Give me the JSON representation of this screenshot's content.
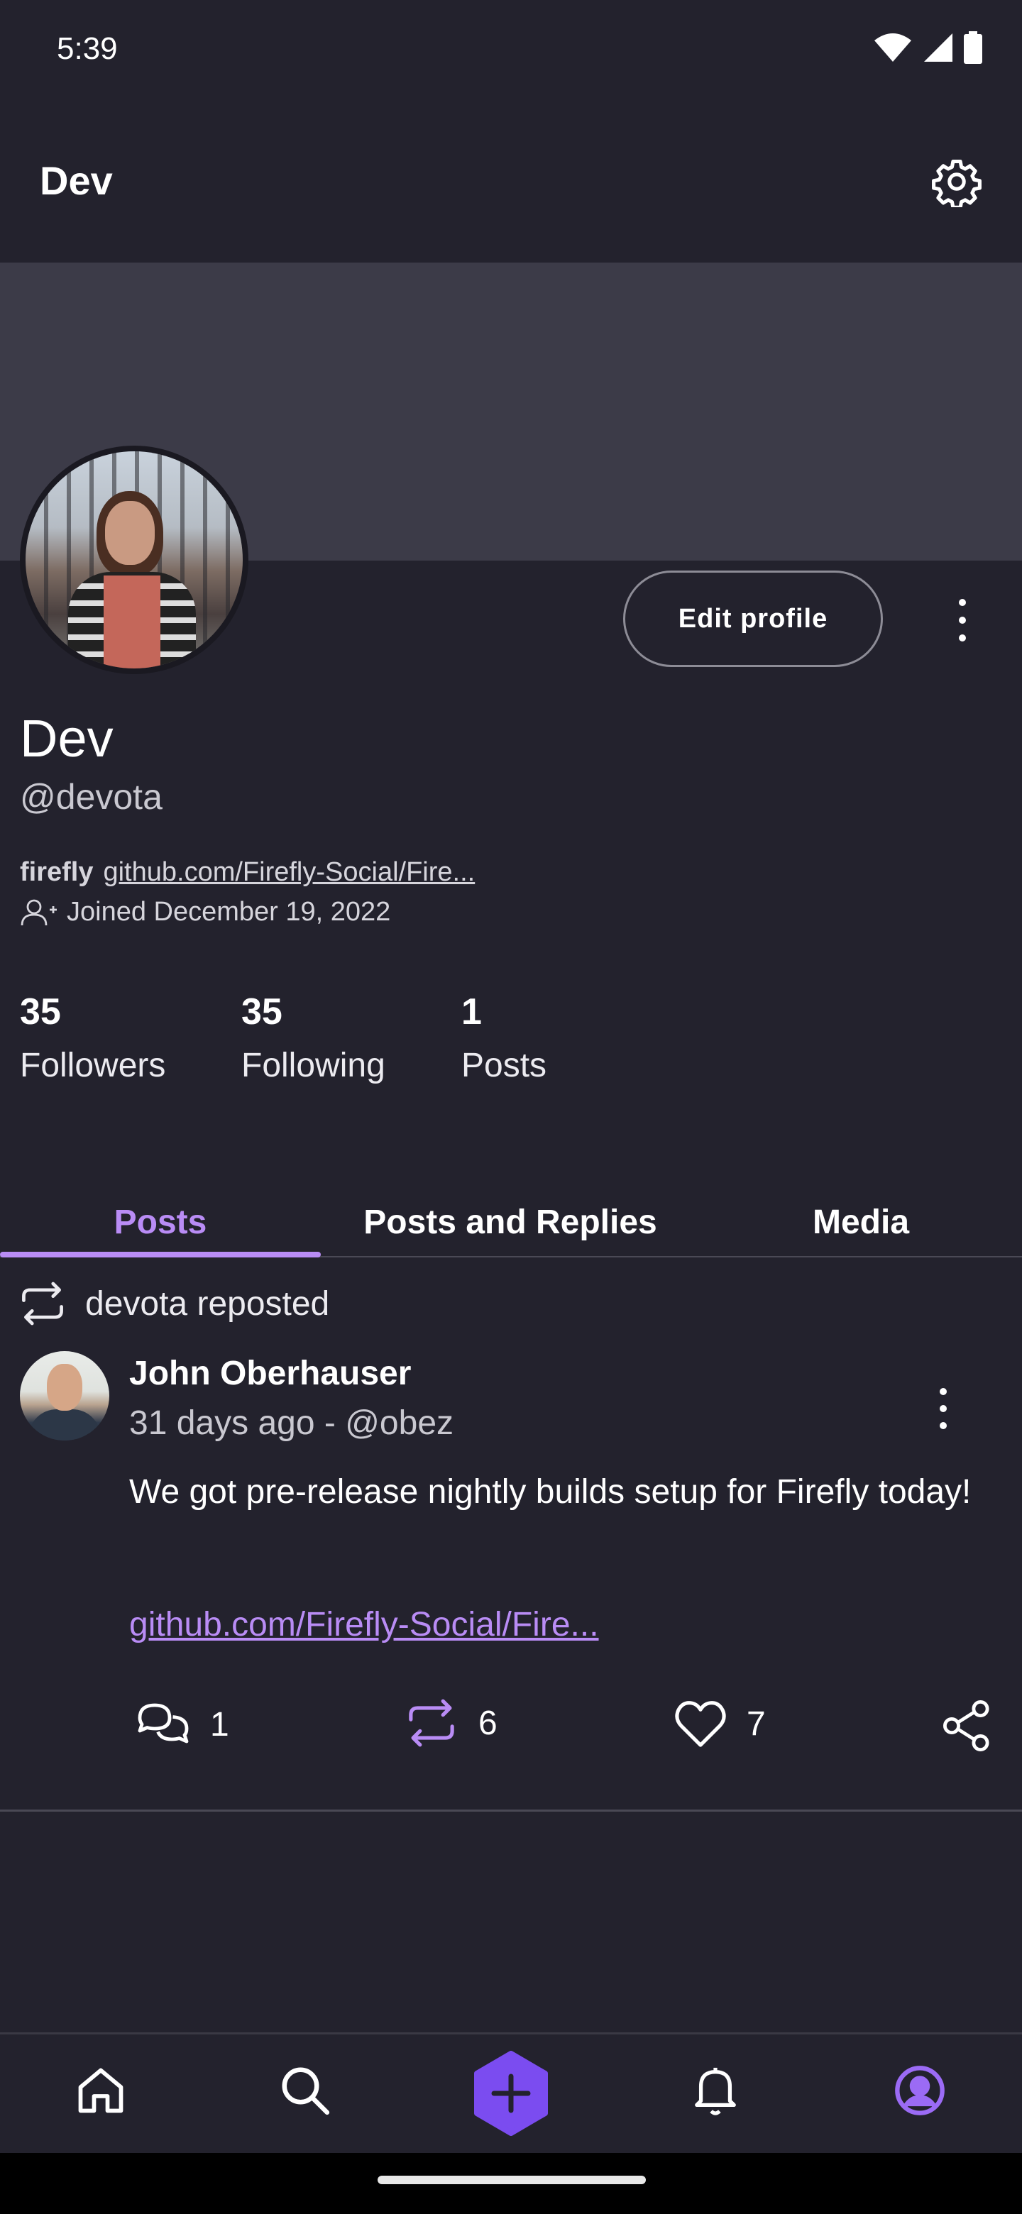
{
  "status_bar": {
    "time": "5:39"
  },
  "header": {
    "title": "Dev"
  },
  "profile": {
    "edit_button": "Edit profile",
    "display_name": "Dev",
    "handle": "@devota",
    "bio_word": "firefly",
    "bio_link": "github.com/Firefly-Social/Fire...",
    "joined": "Joined December 19, 2022"
  },
  "stats": [
    {
      "value": "35",
      "label": "Followers"
    },
    {
      "value": "35",
      "label": "Following"
    },
    {
      "value": "1",
      "label": "Posts"
    }
  ],
  "tabs": [
    {
      "label": "Posts",
      "active": true
    },
    {
      "label": "Posts and Replies",
      "active": false
    },
    {
      "label": "Media",
      "active": false
    }
  ],
  "post": {
    "repost_label": "devota reposted",
    "author": "John Oberhauser",
    "meta": "31 days ago - @obez",
    "text": "We got pre-release nightly builds setup for Firefly today!",
    "link": "github.com/Firefly-Social/Fire...",
    "counts": {
      "replies": "1",
      "reposts": "6",
      "likes": "7"
    }
  },
  "colors": {
    "background": "#23222d",
    "banner": "#3c3b48",
    "accent": "#b98cf5",
    "compose_button": "#7b4cf0"
  },
  "icons": {
    "settings": "gear-icon",
    "reply": "chat-bubbles-icon",
    "repost": "repost-icon",
    "like": "heart-icon",
    "share": "share-icon",
    "home": "home-icon",
    "search": "search-icon",
    "compose": "plus-icon",
    "notifications": "bell-icon",
    "profile": "account-circle-icon"
  }
}
